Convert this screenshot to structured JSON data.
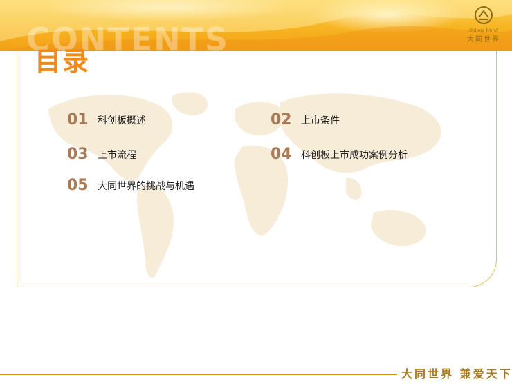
{
  "header": {
    "ghost_text": "CONTENTS",
    "title": "目录"
  },
  "logo": {
    "icon": "datong-logo-icon",
    "english": "Datong World",
    "chinese": "大同世界"
  },
  "toc": [
    {
      "num": "01",
      "label": "科创板概述"
    },
    {
      "num": "02",
      "label": "上市条件"
    },
    {
      "num": "03",
      "label": "上市流程"
    },
    {
      "num": "04",
      "label": "科创板上市成功案例分析"
    },
    {
      "num": "05",
      "label": "大同世界的挑战与机遇"
    }
  ],
  "footer": {
    "slogan": "大同世界 兼爱天下"
  },
  "colors": {
    "banner": "#f7b421",
    "title": "#f08a18",
    "number": "#a87a56",
    "frame": "#e6bf6a",
    "footer": "#a8791c"
  }
}
